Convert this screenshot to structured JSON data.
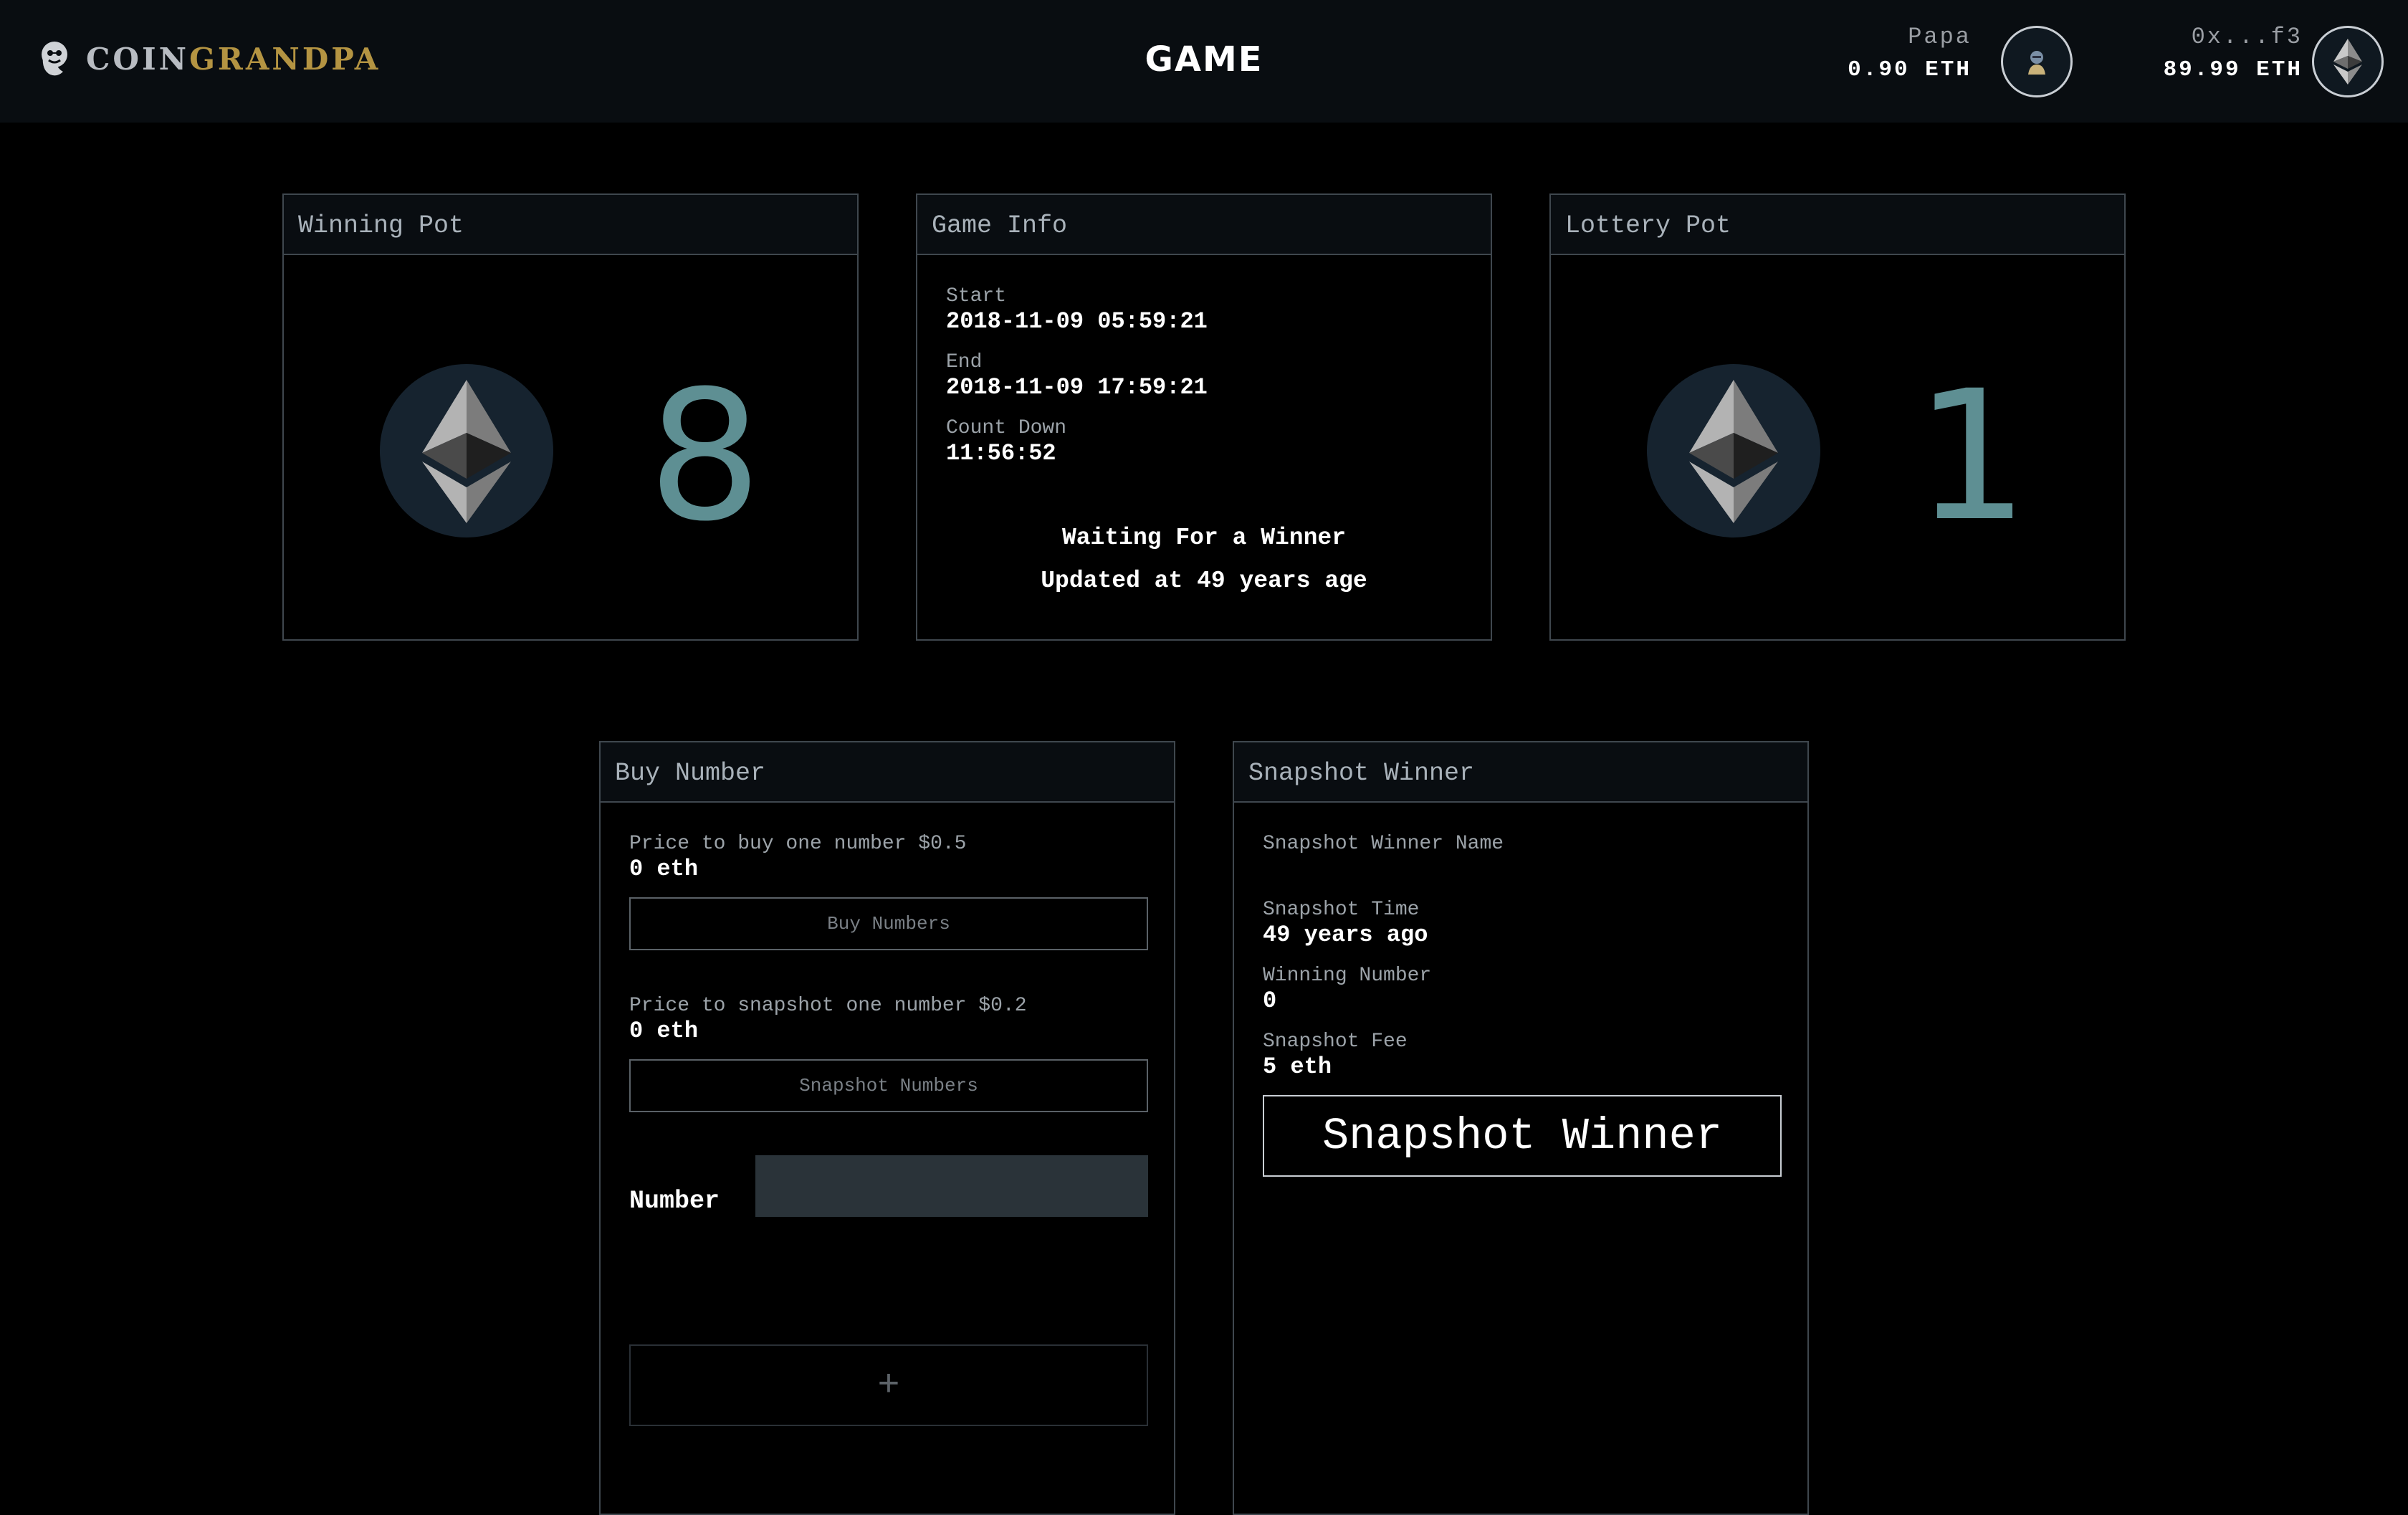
{
  "header": {
    "logo_coin": "COIN",
    "logo_grandpa": "GRANDPA",
    "title": "GAME",
    "account_1": {
      "name": "Papa",
      "balance": "0.90 ETH",
      "avatar_icon": "grandpa-avatar-icon"
    },
    "account_2": {
      "name": "0x...f3",
      "balance": "89.99 ETH",
      "avatar_icon": "ethereum-icon"
    }
  },
  "winning_pot": {
    "title": "Winning Pot",
    "value": "8",
    "icon": "ethereum-coin-icon"
  },
  "game_info": {
    "title": "Game Info",
    "start_label": "Start",
    "start_value": "2018-11-09 05:59:21",
    "end_label": "End",
    "end_value": "2018-11-09 17:59:21",
    "countdown_label": "Count Down",
    "countdown_value": "11:56:52",
    "status": "Waiting For a Winner",
    "updated": "Updated at 49 years age"
  },
  "lottery_pot": {
    "title": "Lottery Pot",
    "value": "1",
    "icon": "ethereum-coin-icon"
  },
  "buy_number": {
    "title": "Buy Number",
    "price_buy_label": "Price to buy one number $0.5",
    "price_buy_value": "0 eth",
    "buy_button": "Buy Numbers",
    "price_snapshot_label": "Price to snapshot one number $0.2",
    "price_snapshot_value": "0 eth",
    "snapshot_button": "Snapshot Numbers",
    "number_label": "Number",
    "number_value": "",
    "add_button": "+"
  },
  "snapshot_winner": {
    "title": "Snapshot Winner",
    "winner_name_label": "Snapshot Winner Name",
    "time_label": "Snapshot Time",
    "time_value": "49 years ago",
    "winning_number_label": "Winning Number",
    "winning_number_value": "0",
    "fee_label": "Snapshot Fee",
    "fee_value": "5 eth",
    "button": "Snapshot Winner"
  },
  "colors": {
    "background": "#000000",
    "header": "#090d11",
    "accent_gold": "#b49442",
    "pot_number": "#5e8f93",
    "coin_bg": "#16232f"
  }
}
